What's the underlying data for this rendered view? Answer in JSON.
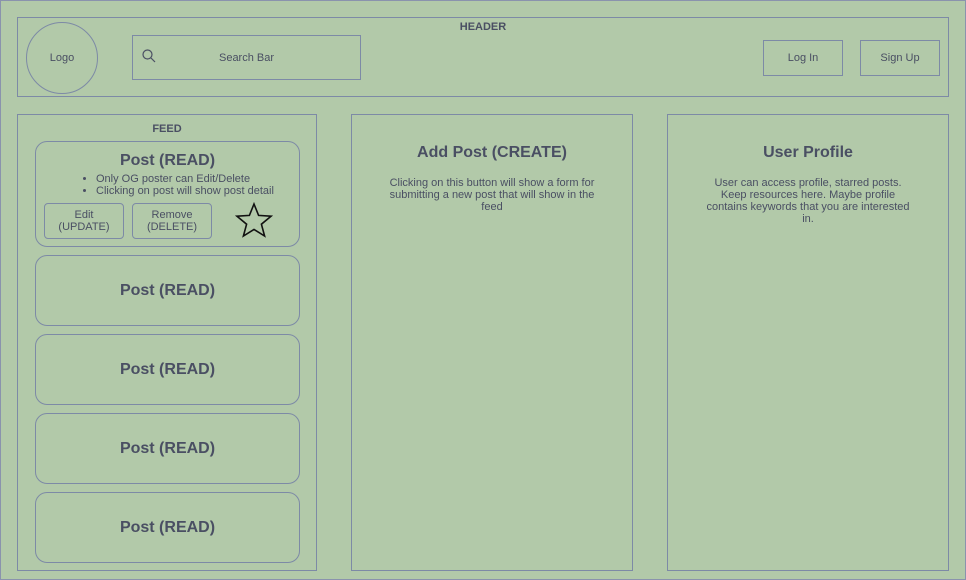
{
  "header": {
    "title": "HEADER",
    "logo": "Logo",
    "search_label": "Search Bar",
    "login_label": "Log In",
    "signup_label": "Sign Up"
  },
  "feed": {
    "title": "FEED",
    "detail_post": {
      "title": "Post (READ)",
      "notes": [
        "Only OG poster can Edit/Delete",
        "Clicking on post will show post detail"
      ],
      "edit_label_1": "Edit",
      "edit_label_2": "(UPDATE)",
      "remove_label_1": "Remove",
      "remove_label_2": "(DELETE)"
    },
    "posts": [
      {
        "title": "Post (READ)"
      },
      {
        "title": "Post (READ)"
      },
      {
        "title": "Post (READ)"
      },
      {
        "title": "Post (READ)"
      }
    ]
  },
  "add_post": {
    "title": "Add Post (CREATE)",
    "description": "Clicking on this button will show a form for submitting a new post that will show in the feed"
  },
  "profile": {
    "title": "User Profile",
    "description": "User can access profile, starred posts. Keep resources here. Maybe profile contains keywords that you are interested in."
  }
}
